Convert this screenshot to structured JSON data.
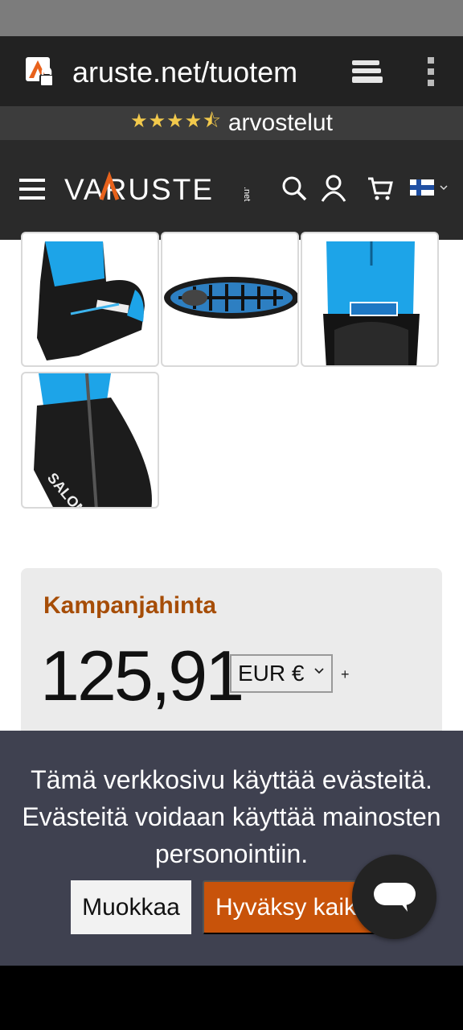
{
  "browser": {
    "url": "aruste.net/tuotem",
    "icons": [
      "site-lock-icon",
      "tabs-icon",
      "more-vert-icon"
    ]
  },
  "reviews": {
    "stars": "★★★★⯪",
    "rating": 4.5,
    "label": "arvostelut",
    "star_color": "#f2c94c"
  },
  "header": {
    "logo_text": "VARUSTE",
    "logo_suffix": ".net",
    "icons": [
      "menu-icon",
      "search-icon",
      "user-icon",
      "cart-icon",
      "finland-flag-icon",
      "chevron-down-icon"
    ]
  },
  "gallery": {
    "images": [
      "salomon-boot-side-rear",
      "salomon-boot-sole",
      "salomon-boot-heel",
      "salomon-boot-zipper-closeup"
    ]
  },
  "price": {
    "label": "Kampanjahinta",
    "value": "125,91",
    "currency": "EUR €",
    "plus": "+",
    "label_color": "#a64d07"
  },
  "cookie": {
    "text": "Tämä verkkosivu käyttää evästeitä. Evästeitä voidaan käyttää mainosten personointiin.",
    "edit_label": "Muokkaa",
    "accept_label": "Hyväksy kaikki",
    "accept_color": "#c8530a",
    "background": "#3f4150"
  },
  "chat": {
    "icon": "chat-bubble-icon"
  }
}
